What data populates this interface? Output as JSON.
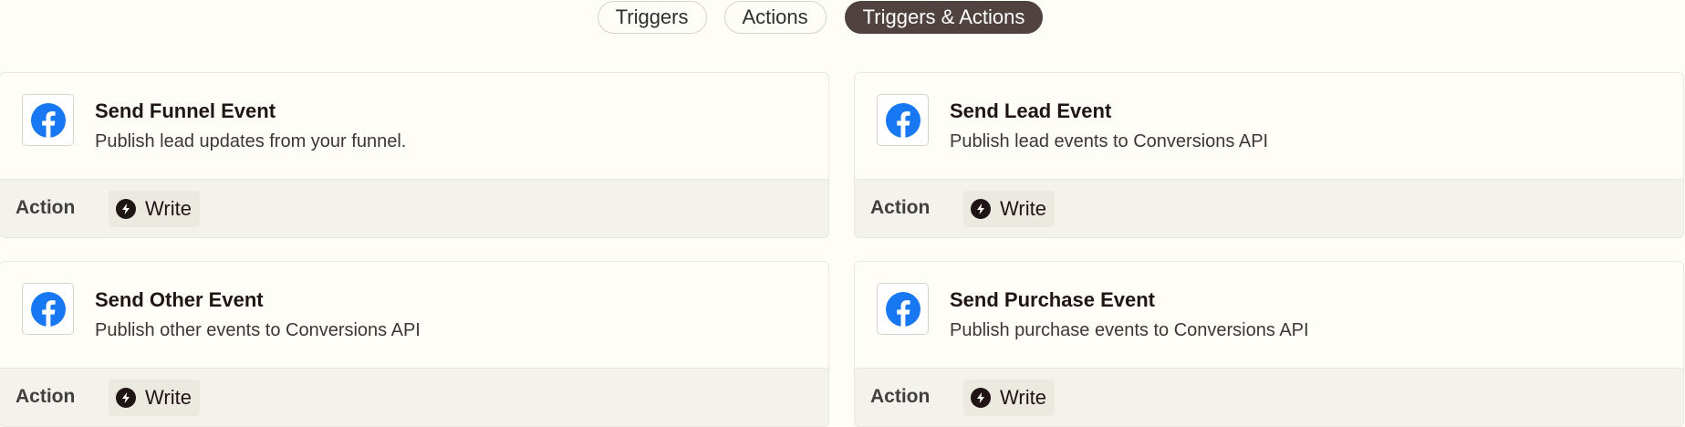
{
  "tabs": [
    {
      "label": "Triggers",
      "active": false
    },
    {
      "label": "Actions",
      "active": false
    },
    {
      "label": "Triggers & Actions",
      "active": true
    }
  ],
  "cards": [
    {
      "title": "Send Funnel Event",
      "description": "Publish lead updates from your funnel.",
      "type": "Action",
      "badge": "Write",
      "icon": "facebook-icon"
    },
    {
      "title": "Send Lead Event",
      "description": "Publish lead events to Conversions API",
      "type": "Action",
      "badge": "Write",
      "icon": "facebook-icon"
    },
    {
      "title": "Send Other Event",
      "description": "Publish other events to Conversions API",
      "type": "Action",
      "badge": "Write",
      "icon": "facebook-icon"
    },
    {
      "title": "Send Purchase Event",
      "description": "Publish purchase events to Conversions API",
      "type": "Action",
      "badge": "Write",
      "icon": "facebook-icon"
    }
  ],
  "colors": {
    "facebook_blue": "#1877f2",
    "active_tab": "#50433f",
    "page_background": "#fffdf8",
    "card_footer": "#f4f2ec"
  }
}
